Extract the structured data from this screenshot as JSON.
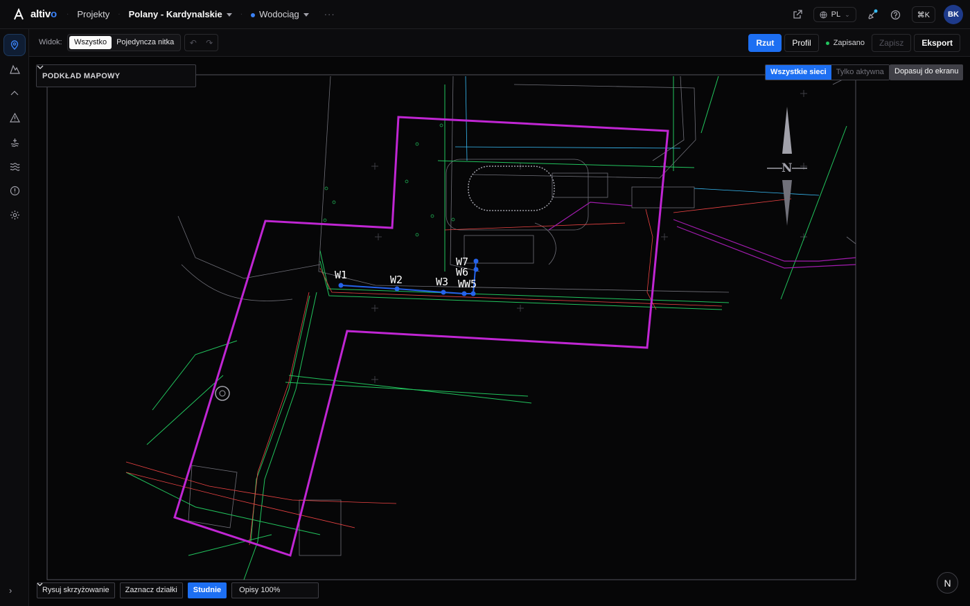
{
  "app": {
    "logo_text_main": "altiv",
    "logo_text_accent": "o"
  },
  "breadcrumb": {
    "projects": "Projekty",
    "project": "Polany - Kardynalskie",
    "network": "Wodociąg",
    "more": "···"
  },
  "topbar": {
    "lang": "PL",
    "shortcut": "⌘K",
    "user_initials": "BK"
  },
  "toolbar": {
    "view_label": "Widok:",
    "view_options": [
      "Wszystko",
      "Pojedyncza nitka"
    ],
    "view_selected": "Wszystko",
    "undo": "↶",
    "redo": "↷",
    "plan_button": "Rzut",
    "profile_button": "Profil",
    "saved_status": "Zapisano",
    "save_button": "Zapisz",
    "export_button": "Eksport"
  },
  "map": {
    "basemap_label": "PODKŁAD MAPOWY",
    "network_filter": [
      "Wszystkie sieci",
      "Tylko aktywna"
    ],
    "network_filter_selected": "Wszystkie sieci",
    "fit_button": "Dopasuj do ekranu",
    "compass_label": "N",
    "wells": [
      "W1",
      "W2",
      "W3",
      "WW5",
      "W6",
      "W7"
    ],
    "colors": {
      "boundary": "#c026d3",
      "pipe": "#2563eb",
      "cad_green": "#22c55e",
      "cad_red": "#ef4444"
    }
  },
  "bottom": {
    "draw_crossing": "Rysuj skrzyżowanie",
    "mark_parcels": "Zaznacz działki",
    "wells": "Studnie",
    "labels_select": "Opisy 100%"
  },
  "north_button": "N",
  "sidebar": {
    "icons": [
      "map-pin-icon",
      "terrain-icon",
      "chevron-up-icon",
      "warning-icon",
      "layers-icon",
      "waves-icon",
      "alert-circle-icon",
      "settings-icon"
    ],
    "expand": "›"
  }
}
